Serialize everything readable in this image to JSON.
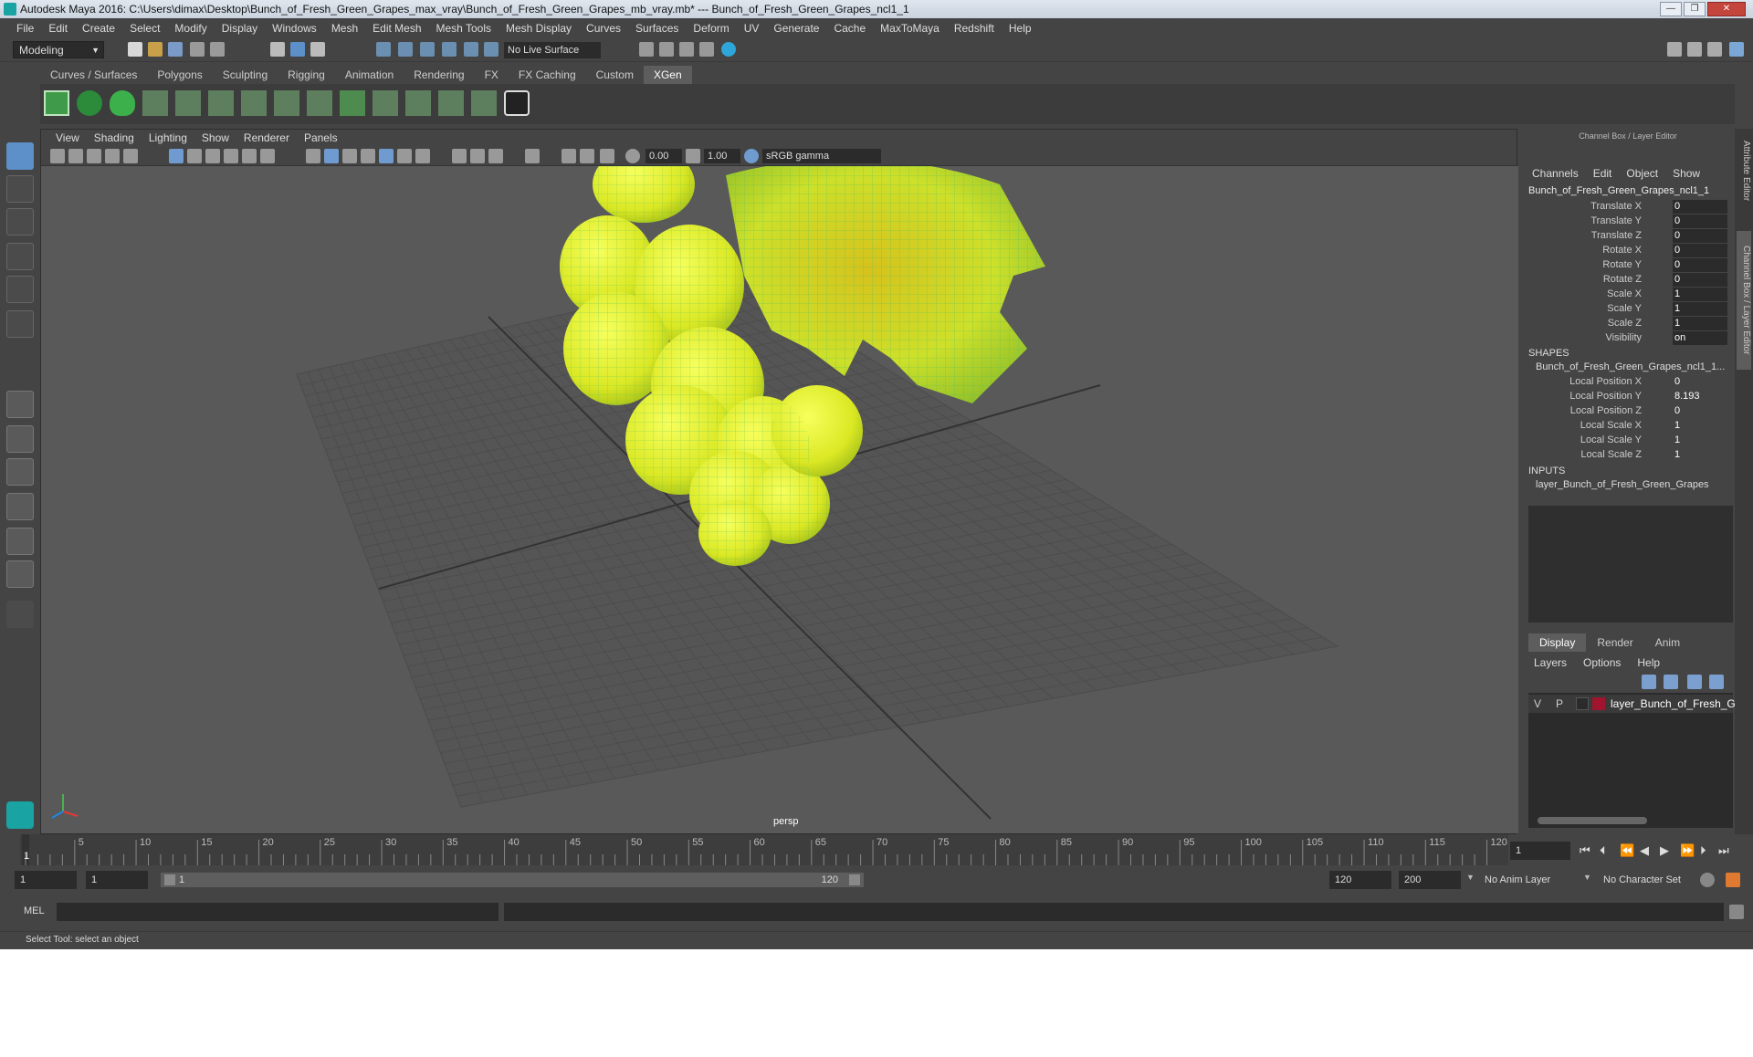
{
  "window": {
    "title": "Autodesk Maya 2016: C:\\Users\\dimax\\Desktop\\Bunch_of_Fresh_Green_Grapes_max_vray\\Bunch_of_Fresh_Green_Grapes_mb_vray.mb*   ---   Bunch_of_Fresh_Green_Grapes_ncl1_1",
    "minimize": "—",
    "maximize": "❐",
    "close": "✕"
  },
  "menubar": [
    "File",
    "Edit",
    "Create",
    "Select",
    "Modify",
    "Display",
    "Windows",
    "Mesh",
    "Edit Mesh",
    "Mesh Tools",
    "Mesh Display",
    "Curves",
    "Surfaces",
    "Deform",
    "UV",
    "Generate",
    "Cache",
    "MaxToMaya",
    "Redshift",
    "Help"
  ],
  "toolbar": {
    "mode": "Modeling",
    "live_surface": "No Live Surface"
  },
  "shelf_tabs": [
    "Curves / Surfaces",
    "Polygons",
    "Sculpting",
    "Rigging",
    "Animation",
    "Rendering",
    "FX",
    "FX Caching",
    "Custom",
    "XGen"
  ],
  "shelf_active": "XGen",
  "viewport": {
    "menu": [
      "View",
      "Shading",
      "Lighting",
      "Show",
      "Renderer",
      "Panels"
    ],
    "exposure": "0.00",
    "gamma": "1.00",
    "color_space": "sRGB gamma",
    "camera_label": "persp"
  },
  "channel_box": {
    "header": "Channel Box / Layer Editor",
    "menu": [
      "Channels",
      "Edit",
      "Object",
      "Show"
    ],
    "object_name": "Bunch_of_Fresh_Green_Grapes_ncl1_1",
    "channels": [
      {
        "label": "Translate X",
        "value": "0"
      },
      {
        "label": "Translate Y",
        "value": "0"
      },
      {
        "label": "Translate Z",
        "value": "0"
      },
      {
        "label": "Rotate X",
        "value": "0"
      },
      {
        "label": "Rotate Y",
        "value": "0"
      },
      {
        "label": "Rotate Z",
        "value": "0"
      },
      {
        "label": "Scale X",
        "value": "1"
      },
      {
        "label": "Scale Y",
        "value": "1"
      },
      {
        "label": "Scale Z",
        "value": "1"
      },
      {
        "label": "Visibility",
        "value": "on"
      }
    ],
    "shapes_title": "SHAPES",
    "shape_name": "Bunch_of_Fresh_Green_Grapes_ncl1_1...",
    "shape_channels": [
      {
        "label": "Local Position X",
        "value": "0"
      },
      {
        "label": "Local Position Y",
        "value": "8.193"
      },
      {
        "label": "Local Position Z",
        "value": "0"
      },
      {
        "label": "Local Scale X",
        "value": "1"
      },
      {
        "label": "Local Scale Y",
        "value": "1"
      },
      {
        "label": "Local Scale Z",
        "value": "1"
      }
    ],
    "inputs_title": "INPUTS",
    "input_name": "layer_Bunch_of_Fresh_Green_Grapes"
  },
  "layer_editor": {
    "tabs": [
      "Display",
      "Render",
      "Anim"
    ],
    "active_tab": "Display",
    "menu": [
      "Layers",
      "Options",
      "Help"
    ],
    "layer": {
      "v": "V",
      "p": "P",
      "name": "layer_Bunch_of_Fresh_G",
      "color": "#a0142e"
    }
  },
  "side_tabs": [
    "Attribute Editor",
    "Channel Box / Layer Editor"
  ],
  "timeline": {
    "ticks": [
      "5",
      "10",
      "15",
      "20",
      "25",
      "30",
      "35",
      "40",
      "45",
      "50",
      "55",
      "60",
      "65",
      "70",
      "75",
      "80",
      "85",
      "90",
      "95",
      "100",
      "105",
      "110",
      "115",
      "120"
    ],
    "current_frame": "1",
    "current_field": "1"
  },
  "range": {
    "start": "1",
    "playback_start": "1",
    "slider_start": "1",
    "slider_end": "120",
    "playback_end": "120",
    "end": "200",
    "anim_layer": "No Anim Layer",
    "character_set": "No Character Set"
  },
  "mel": {
    "label": "MEL"
  },
  "status": "Select Tool: select an object",
  "colors": {
    "accent": "#5d5d5d",
    "grape": "#e6f230",
    "wire": "#2eae4a",
    "layer": "#a0142e"
  }
}
